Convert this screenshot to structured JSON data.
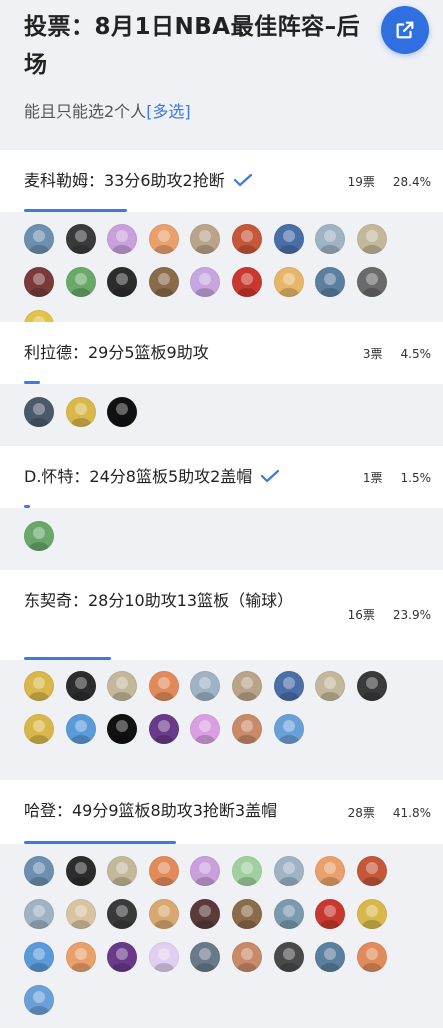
{
  "header": {
    "title": "投票：8月1日NBA最佳阵容–后场",
    "subtitle_prefix": "能且只能选2个人",
    "subtitle_link": "[多选]"
  },
  "colors": {
    "accent": "#3b7ae0",
    "share_button": "#2f6fe0"
  },
  "options": [
    {
      "label": "麦科勒姆：33分6助攻2抢断",
      "checked": true,
      "votes": "19票",
      "percent": "28.4%",
      "share": 0.284,
      "avatars": [
        "#6d8fb0",
        "#3a3a3a",
        "#c9a0dc",
        "#e9a06b",
        "#b9a489",
        "#c5573a",
        "#4a6ea8",
        "#9fb3c4",
        "#c4b89a",
        "#7a3a3a",
        "#6aa86a",
        "#2c2c2c",
        "#8a6b4a",
        "#c7a6e0",
        "#c8382f",
        "#e7b66a",
        "#5b7f9f",
        "#6a6a6a",
        "#e2c24a"
      ]
    },
    {
      "label": "利拉德：29分5篮板9助攻",
      "checked": false,
      "votes": "3票",
      "percent": "4.5%",
      "share": 0.045,
      "avatars": [
        "#4a5a6a",
        "#d8b84a",
        "#111111"
      ]
    },
    {
      "label": "D.怀特：24分8篮板5助攻2盖帽",
      "checked": true,
      "votes": "1票",
      "percent": "1.5%",
      "share": 0.015,
      "avatars": [
        "#6aa86a"
      ]
    },
    {
      "label": "东契奇：28分10助攻13篮板（输球）",
      "checked": false,
      "votes": "16票",
      "percent": "23.9%",
      "share": 0.239,
      "avatars": [
        "#d8b84a",
        "#2c2c2c",
        "#c4b89a",
        "#e28b5a",
        "#9fb3c4",
        "#b9a489",
        "#4a6ea8",
        "#c4b89a",
        "#3a3a3a",
        "#d8b84a",
        "#5a9ad8",
        "#111111",
        "#6a3a8a",
        "#d8a0e0",
        "#c98a6a",
        "#6aa0d8"
      ]
    },
    {
      "label": "哈登：49分9篮板8助攻3抢断3盖帽",
      "checked": false,
      "votes": "28票",
      "percent": "41.8%",
      "share": 0.418,
      "avatars": [
        "#6d8fb0",
        "#2c2c2c",
        "#c4b89a",
        "#e28b5a",
        "#c9a0dc",
        "#a0d0a0",
        "#9fb3c4",
        "#e9a06b",
        "#c5573a",
        "#9fb3c4",
        "#d8c4a0",
        "#3a3a3a",
        "#d8a870",
        "#5a3a3a",
        "#8a6b4a",
        "#7a9ab0",
        "#c8382f",
        "#d8b84a",
        "#5a9ad8",
        "#e9a06b",
        "#6a3a8a",
        "#e0d0f0",
        "#6a7a8a",
        "#c98a6a",
        "#4a4a4a",
        "#5b7f9f",
        "#e28b5a",
        "#6aa0d8"
      ]
    }
  ]
}
